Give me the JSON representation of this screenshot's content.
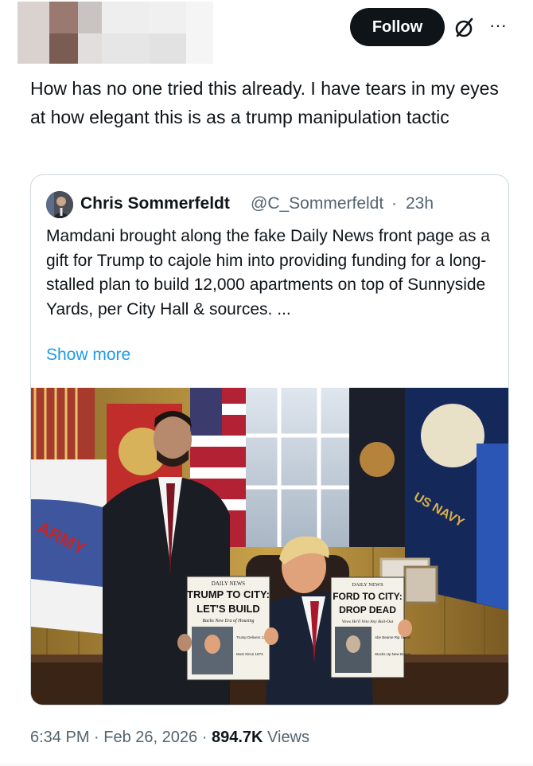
{
  "header": {
    "follow_label": "Follow",
    "grok_icon": "grok-slash-icon",
    "more_icon": "more-horizontal-icon",
    "more_glyph": "···"
  },
  "tweet": {
    "text": "How has no one tried this already. I have tears in my eyes at how elegant this is as  a trump manipulation tactic"
  },
  "quote": {
    "name": "Chris Sommerfeldt",
    "handle": "@C_Sommerfeldt",
    "separator": "·",
    "time": "23h",
    "text": "Mamdani brought along the fake Daily News front page as a gift for Trump to cajole him into providing funding for a long-stalled plan to build 12,000 apartments on top of Sunnyside Yards, per City Hall & sources. ...",
    "show_more": "Show more",
    "photo": {
      "flag_left_text": "ARMY",
      "flag_right_text": "US NAVY",
      "left_paper": {
        "masthead": "DAILY NEWS",
        "headline_1": "TRUMP TO CITY:",
        "headline_2": "LET'S BUILD",
        "subhead": "Backs New Era of Housing",
        "side_1": "Trump Delivers 12,000+ Homes",
        "side_2": "Most Since 1973"
      },
      "right_paper": {
        "masthead": "DAILY NEWS",
        "headline_1": "FORD TO CITY:",
        "headline_2": "DROP DEAD",
        "subhead": "Vows He'll Veto Any Bail-Out",
        "side_1": "Abe Beame Rip Stand",
        "side_2": "Stocks Up New Bonus"
      }
    }
  },
  "meta": {
    "time": "6:34 PM",
    "date": "Feb 26, 2026",
    "separator": "·",
    "views_count": "894.7K",
    "views_label": "Views"
  },
  "colors": {
    "text": "#0f1419",
    "muted": "#536471",
    "link": "#1d9bf0",
    "border": "#cfd9de",
    "follow_bg": "#0f1419"
  }
}
